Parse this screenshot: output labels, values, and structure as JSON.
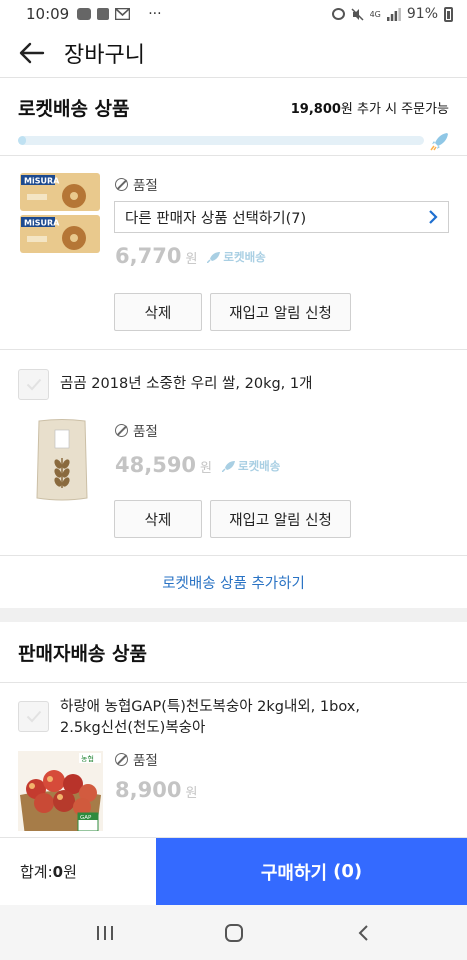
{
  "status_bar": {
    "time": "10:09",
    "notif_icons": [
      "talk-icon",
      "square-icon",
      "mail-icon"
    ],
    "more": "···",
    "signal": "4G",
    "battery": "91%"
  },
  "header": {
    "title": "장바구니"
  },
  "rocket_section": {
    "title": "로켓배송 상품",
    "free_ship_amount": "19,800",
    "free_ship_text": "원 추가 시 주문가능",
    "progress_fraction": 0.02,
    "add_more": "로켓배송 상품 추가하기"
  },
  "items": [
    {
      "name": "",
      "soldout": "품절",
      "other_seller": "다른 판매자 상품 선택하기(7)",
      "price": "6,770",
      "won": "원",
      "rocket_tag": "로켓배송",
      "delete": "삭제",
      "restock": "재입고 알림 신청",
      "brand": "MISURA"
    },
    {
      "name": "곰곰 2018년 소중한 우리 쌀, 20kg, 1개",
      "soldout": "품절",
      "price": "48,590",
      "won": "원",
      "rocket_tag": "로켓배송",
      "delete": "삭제",
      "restock": "재입고 알림 신청"
    }
  ],
  "seller_section": {
    "title": "판매자배송 상품",
    "item": {
      "name_line1": "하랑애 농협GAP(특)천도복숭아 2kg내외, 1box,",
      "name_line2": "2.5kg신선(천도)복숭아",
      "soldout": "품절",
      "price": "8,900",
      "won": "원",
      "badge_top": "농협",
      "badge_gap": "GAP"
    }
  },
  "bottom": {
    "total_label": "합계: ",
    "total_value": "0",
    "total_unit": "원",
    "buy_label": "구매하기",
    "buy_count": "(0)"
  },
  "colors": {
    "accent": "#346aff",
    "link": "#2a73c4",
    "rocket": "#a9cfe3"
  }
}
